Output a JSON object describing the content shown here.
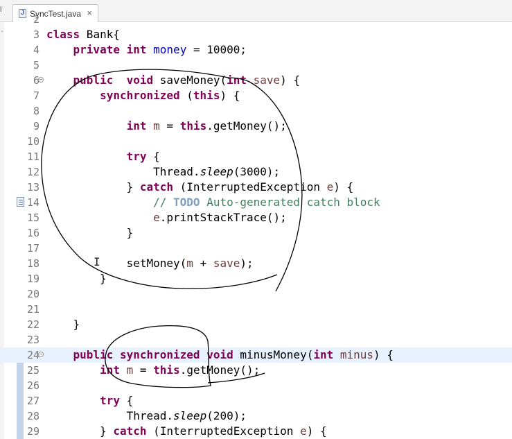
{
  "tab": {
    "title": "SyncTest.java",
    "close": "×",
    "prev_edge": "l"
  },
  "editor": {
    "lines": [
      {
        "n": "2",
        "text": ""
      },
      {
        "n": "3",
        "text": "class Bank{"
      },
      {
        "n": "4",
        "text": "    private int money = 10000;"
      },
      {
        "n": "5",
        "text": ""
      },
      {
        "n": "6",
        "text": "    public  void saveMoney(int save) {"
      },
      {
        "n": "7",
        "text": "        synchronized (this) {"
      },
      {
        "n": "8",
        "text": ""
      },
      {
        "n": "9",
        "text": "            int m = this.getMoney();"
      },
      {
        "n": "10",
        "text": ""
      },
      {
        "n": "11",
        "text": "            try {"
      },
      {
        "n": "12",
        "text": "                Thread.sleep(3000);"
      },
      {
        "n": "13",
        "text": "            } catch (InterruptedException e) {"
      },
      {
        "n": "14",
        "text": "                // TODO Auto-generated catch block"
      },
      {
        "n": "15",
        "text": "                e.printStackTrace();"
      },
      {
        "n": "16",
        "text": "            }"
      },
      {
        "n": "17",
        "text": ""
      },
      {
        "n": "18",
        "text": "            setMoney(m + save);"
      },
      {
        "n": "19",
        "text": "        }"
      },
      {
        "n": "20",
        "text": ""
      },
      {
        "n": "21",
        "text": ""
      },
      {
        "n": "22",
        "text": "    }"
      },
      {
        "n": "23",
        "text": ""
      },
      {
        "n": "24",
        "text": "    public synchronized void minusMoney(int minus) {"
      },
      {
        "n": "25",
        "text": "        int m = this.getMoney();"
      },
      {
        "n": "26",
        "text": ""
      },
      {
        "n": "27",
        "text": "        try {"
      },
      {
        "n": "28",
        "text": "            Thread.sleep(200);"
      },
      {
        "n": "29",
        "text": "        } catch (InterruptedException e) {"
      }
    ],
    "current_line": "24"
  },
  "colors": {
    "keyword": "#7f0055",
    "field": "#0000c0",
    "param": "#6a3e3e",
    "comment": "#3f7f5f",
    "todo": "#7f9fbf",
    "current_line_bg": "#e8f2fe"
  },
  "icons": [
    "java-file-icon",
    "close-icon",
    "fold-collapse-icon",
    "task-marker-icon",
    "text-cursor-icon"
  ]
}
